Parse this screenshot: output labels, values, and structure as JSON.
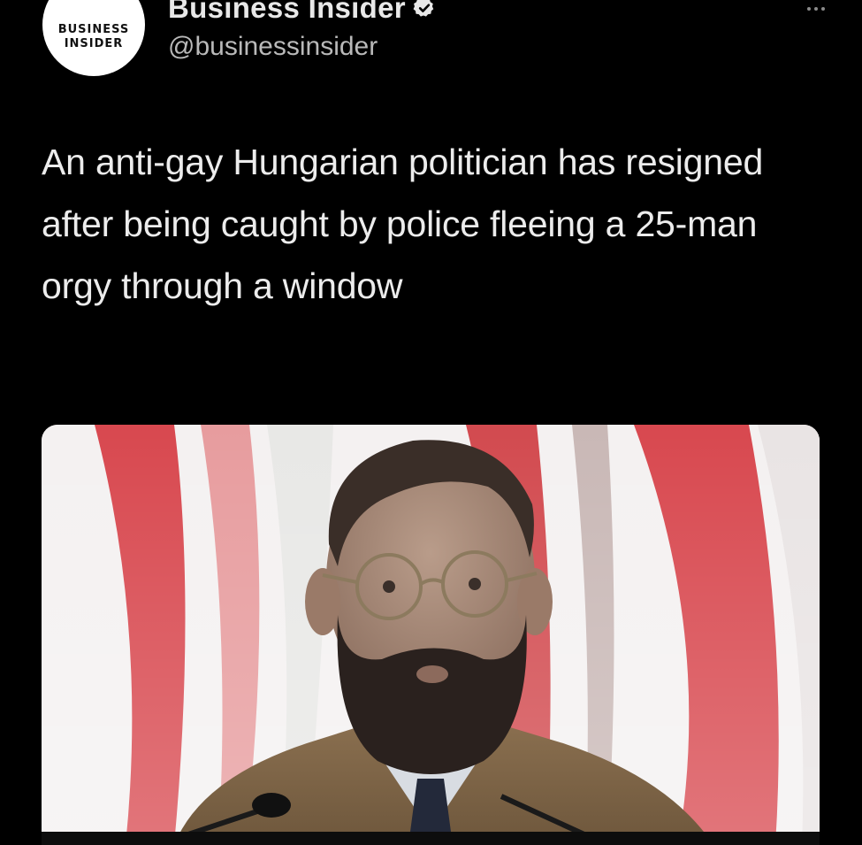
{
  "tweet": {
    "author": {
      "avatar_logo_line1": "BUSINESS",
      "avatar_logo_line2": "INSIDER",
      "display_name": "Business Insider",
      "handle": "@businessinsider",
      "verified": true
    },
    "text": "An anti-gay Hungarian politician has resigned after being caught by police fleeing a 25-man orgy through a window",
    "media": {
      "description_icon": "photo-of-politician"
    },
    "more_icon": "ellipsis-icon"
  },
  "colors": {
    "background": "#000000",
    "text": "#ececec",
    "handle": "#b9b9b9",
    "verified": "#e8e8e8",
    "flag_red": "#d8484f",
    "flag_white": "#f4f1f1"
  }
}
